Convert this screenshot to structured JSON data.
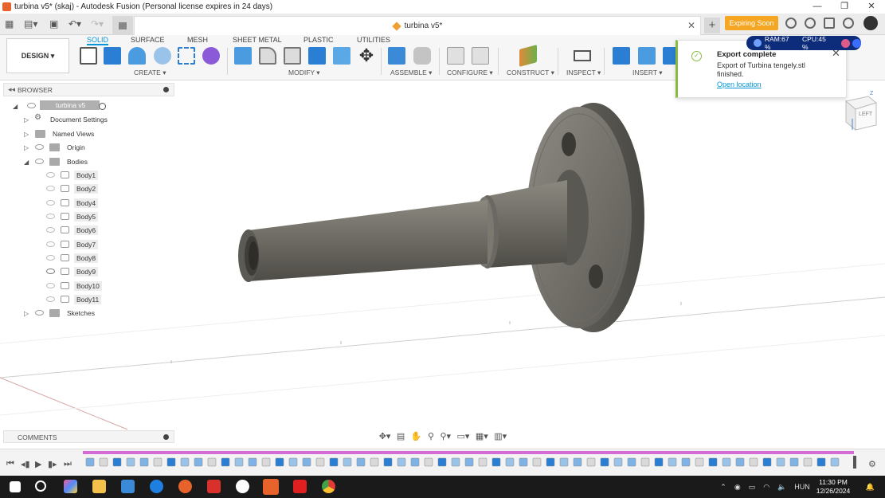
{
  "window": {
    "title": "turbina v5* (skaj) - Autodesk Fusion (Personal license expires in 24 days)"
  },
  "tabs": {
    "document": "turbina v5*",
    "expiring_label": "Expiring Soon"
  },
  "toolbar": {
    "design_label": "DESIGN ▾",
    "workspace_tabs": [
      "SOLID",
      "SURFACE",
      "MESH",
      "SHEET METAL",
      "PLASTIC",
      "UTILITIES"
    ],
    "groups": {
      "create": "CREATE ▾",
      "modify": "MODIFY ▾",
      "assemble": "ASSEMBLE ▾",
      "configure": "CONFIGURE ▾",
      "construct": "CONSTRUCT ▾",
      "inspect": "INSPECT ▾",
      "insert": "INSERT ▾"
    }
  },
  "notification": {
    "title": "Export complete",
    "message": "Export of Turbina tengely.stl finished.",
    "link": "Open location"
  },
  "performance": {
    "ram": "RAM:67 %",
    "cpu": "CPU:45 %"
  },
  "browser": {
    "label": "BROWSER",
    "root": "turbina v5",
    "document_settings": "Document Settings",
    "named_views": "Named Views",
    "origin": "Origin",
    "bodies": "Bodies",
    "body_items": [
      "Body1",
      "Body2",
      "Body4",
      "Body5",
      "Body6",
      "Body7",
      "Body8",
      "Body9",
      "Body10",
      "Body11"
    ],
    "sketches": "Sketches"
  },
  "comments": {
    "label": "COMMENTS"
  },
  "viewcube": {
    "face": "LEFT",
    "axis": "Z"
  },
  "taskbar": {
    "lang": "HUN",
    "time": "11:30 PM",
    "date": "12/26/2024"
  }
}
